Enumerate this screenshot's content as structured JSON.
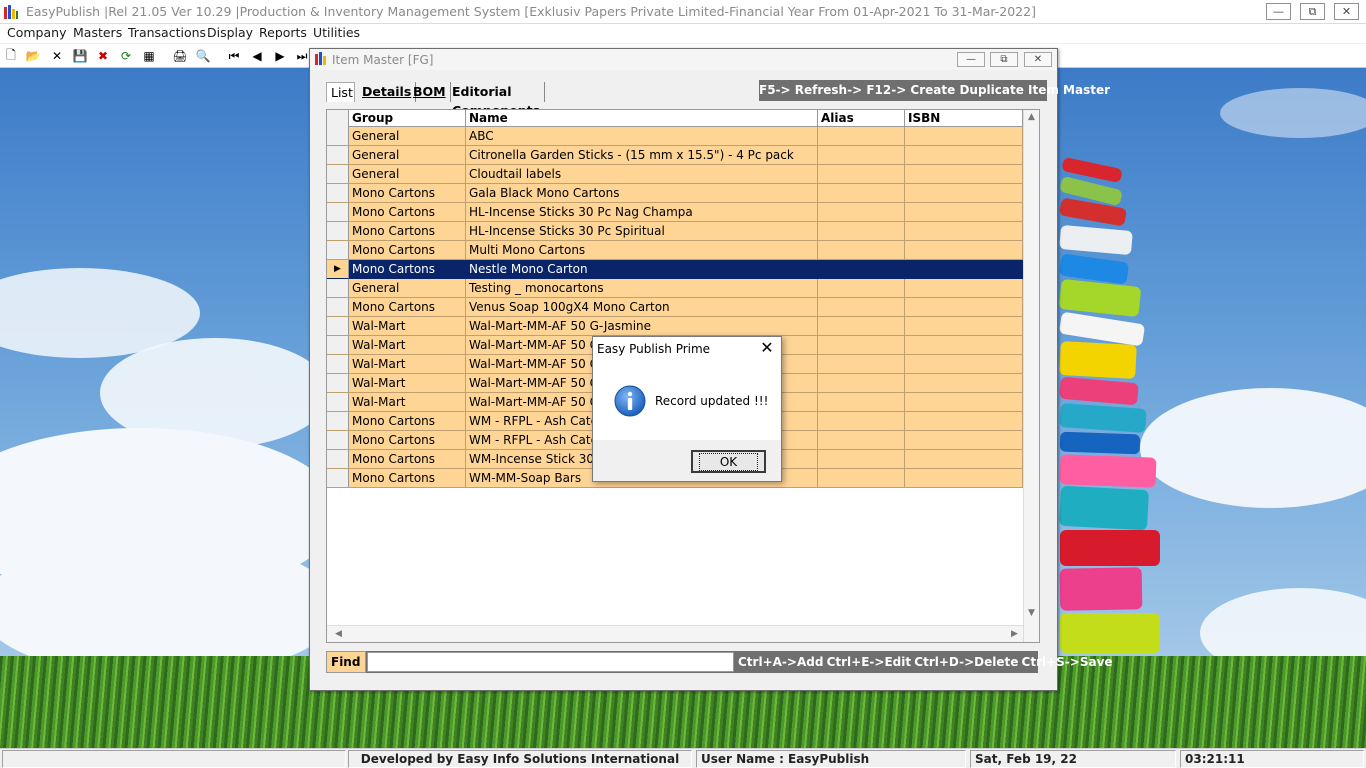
{
  "app": {
    "title": "EasyPublish |Rel 21.05 Ver 10.29 |Production & Inventory Management System [Exklusiv Papers Private Limited-Financial Year From 01-Apr-2021 To 31-Mar-2022]",
    "window_buttons": {
      "minimize": "—",
      "restore": "⧉",
      "close": "✕"
    }
  },
  "menu": [
    "Company",
    "Masters",
    "Transactions",
    "Display",
    "Reports",
    "Utilities"
  ],
  "toolbar": {
    "icons": [
      "new-icon",
      "open-icon",
      "delete-icon",
      "save-icon",
      "cancel-icon",
      "refresh-icon",
      "calculator-icon",
      "print-icon",
      "print-preview-icon",
      "first-record-icon",
      "previous-record-icon",
      "next-record-icon",
      "last-record-icon"
    ],
    "glyphs": [
      "🗋",
      "📂",
      "✕",
      "💾",
      "✖",
      "⟳",
      "▦",
      "🖨",
      "🔍",
      "⏮",
      "◀",
      "▶",
      "⏭"
    ]
  },
  "child_window": {
    "title": "Item Master [FG]",
    "tabs": [
      "List",
      "Details",
      "BOM",
      "Editorial Components"
    ],
    "hint": "F5-> Refresh-> F12-> Create Duplicate Item Master",
    "columns": [
      "Group",
      "Name",
      "Alias",
      "ISBN"
    ],
    "rows": [
      {
        "group": "General",
        "name": "ABC",
        "alias": "",
        "isbn": ""
      },
      {
        "group": "General",
        "name": "Citronella Garden Sticks - (15 mm x 15.5\") - 4 Pc pack",
        "alias": "",
        "isbn": ""
      },
      {
        "group": "General",
        "name": "Cloudtail labels",
        "alias": "",
        "isbn": ""
      },
      {
        "group": "Mono Cartons",
        "name": "Gala Black Mono Cartons",
        "alias": "",
        "isbn": ""
      },
      {
        "group": "Mono Cartons",
        "name": "HL-Incense Sticks 30 Pc Nag Champa",
        "alias": "",
        "isbn": ""
      },
      {
        "group": "Mono Cartons",
        "name": "HL-Incense Sticks 30 Pc Spiritual",
        "alias": "",
        "isbn": ""
      },
      {
        "group": "Mono Cartons",
        "name": "Multi Mono Cartons",
        "alias": "",
        "isbn": ""
      },
      {
        "group": "Mono Cartons",
        "name": "Nestle Mono Carton",
        "alias": "",
        "isbn": "",
        "selected": true
      },
      {
        "group": "General",
        "name": "Testing _ monocartons",
        "alias": "",
        "isbn": ""
      },
      {
        "group": "Mono Cartons",
        "name": "Venus Soap 100gX4 Mono Carton",
        "alias": "",
        "isbn": ""
      },
      {
        "group": "Wal-Mart",
        "name": "Wal-Mart-MM-AF 50 G-Jasmine",
        "alias": "",
        "isbn": ""
      },
      {
        "group": "Wal-Mart",
        "name": "Wal-Mart-MM-AF 50 G",
        "alias": "",
        "isbn": ""
      },
      {
        "group": "Wal-Mart",
        "name": "Wal-Mart-MM-AF 50 G",
        "alias": "",
        "isbn": ""
      },
      {
        "group": "Wal-Mart",
        "name": "Wal-Mart-MM-AF 50 G",
        "alias": "",
        "isbn": ""
      },
      {
        "group": "Wal-Mart",
        "name": "Wal-Mart-MM-AF 50 G",
        "alias": "",
        "isbn": ""
      },
      {
        "group": "Mono Cartons",
        "name": "WM - RFPL - Ash Catche",
        "alias": "",
        "isbn": ""
      },
      {
        "group": "Mono Cartons",
        "name": "WM - RFPL - Ash Catche",
        "alias": "",
        "isbn": ""
      },
      {
        "group": "Mono Cartons",
        "name": "WM-Incense Stick 30 P",
        "alias": "",
        "isbn": ""
      },
      {
        "group": "Mono Cartons",
        "name": "WM-MM-Soap Bars",
        "alias": "",
        "isbn": ""
      }
    ],
    "find_label": "Find",
    "find_value": "",
    "shortcuts": "Ctrl+A->Add  Ctrl+E->Edit  Ctrl+D->Delete  Ctrl+S->Save"
  },
  "dialog": {
    "title": "Easy Publish Prime",
    "message": "Record updated !!!",
    "ok_label": "OK",
    "close_glyph": "✕"
  },
  "status_bar": {
    "developer": "Developed by Easy Info Solutions International",
    "user": "User Name : EasyPublish",
    "date": "Sat, Feb 19, 22",
    "time": "03:21:11"
  },
  "colors": {
    "row_bg": "#ffd596",
    "selected_bg": "#0a246a",
    "banner_bg": "#6f6f6f"
  }
}
